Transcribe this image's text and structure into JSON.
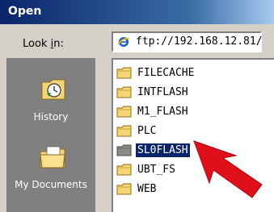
{
  "window": {
    "title": "Open"
  },
  "lookin": {
    "label_prefix": "Look ",
    "label_underline": "i",
    "label_suffix": "n:",
    "value": "ftp://192.168.12.81/",
    "icon": "internet-explorer-icon"
  },
  "places": [
    {
      "label": "History",
      "icon": "history-icon"
    },
    {
      "label": "My Documents",
      "icon": "my-documents-icon"
    }
  ],
  "files": [
    {
      "name": "FILECACHE",
      "selected": false
    },
    {
      "name": "INTFLASH",
      "selected": false
    },
    {
      "name": "M1_FLASH",
      "selected": false
    },
    {
      "name": "PLC",
      "selected": false
    },
    {
      "name": "SL0FLASH",
      "selected": true
    },
    {
      "name": "UBT_FS",
      "selected": false
    },
    {
      "name": "WEB",
      "selected": false
    }
  ],
  "colors": {
    "titlebar": "#0a246a",
    "selection": "#0a246a",
    "annotation_arrow": "#e0101a",
    "folder": "#f5d574"
  }
}
